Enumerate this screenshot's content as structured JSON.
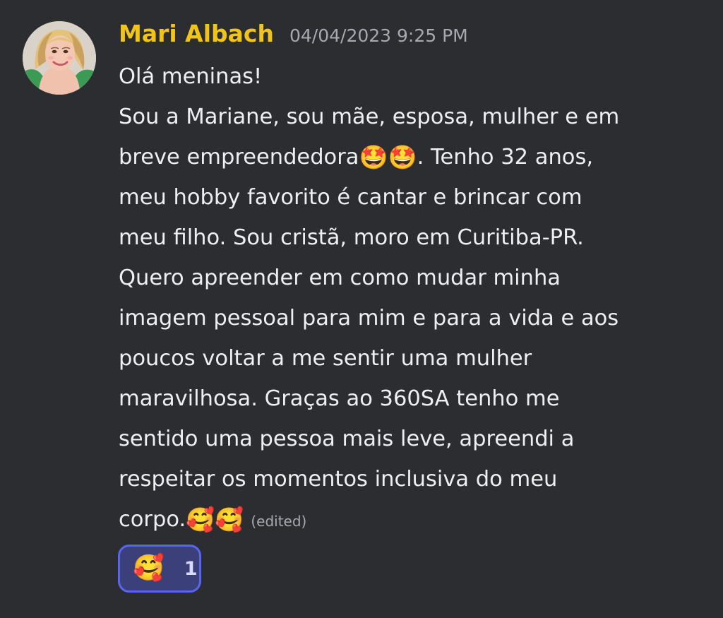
{
  "message": {
    "author": "Mari Albach",
    "timestamp": "04/04/2023 9:25 PM",
    "edited_label": "(edited)",
    "lines": [
      {
        "before_emoji": "Olá meninas!"
      },
      {
        "before_emoji": "Sou a Mariane, sou mãe, esposa, mulher e em"
      },
      {
        "before_emoji": "breve empreendedora",
        "emoji": "🤩🤩",
        "after_emoji": ". Tenho 32 anos,"
      },
      {
        "before_emoji": "meu hobby favorito é cantar e brincar com"
      },
      {
        "before_emoji": "meu filho. Sou cristã, moro em Curitiba-PR."
      },
      {
        "before_emoji": "Quero apreender em como mudar minha"
      },
      {
        "before_emoji": "imagem pessoal para mim e para a vida e aos"
      },
      {
        "before_emoji": "poucos voltar a me sentir uma mulher"
      },
      {
        "before_emoji": "maravilhosa. Graças ao 360SA tenho me"
      },
      {
        "before_emoji": "sentido uma pessoa mais leve, apreendi a"
      },
      {
        "before_emoji": "respeitar os momentos inclusiva do meu"
      },
      {
        "before_emoji": "corpo.",
        "emoji": "🥰🥰"
      }
    ]
  },
  "reaction": {
    "emoji": "🥰",
    "count": "1"
  },
  "colors": {
    "background": "#2b2d31",
    "username": "#f0c419",
    "text": "#eeeff1",
    "muted": "#a6a9b0",
    "reaction_border": "#5865f2",
    "reaction_background": "#3b3f7a"
  },
  "icons": {
    "avatar": "user-avatar"
  }
}
